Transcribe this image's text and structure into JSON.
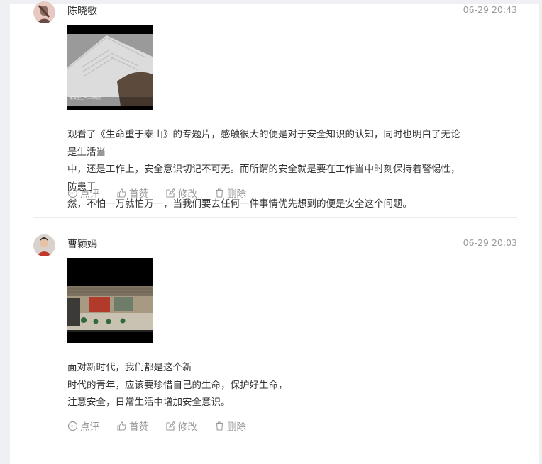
{
  "posts": [
    {
      "username": "陈晓敏",
      "time": "06-29 20:43",
      "thumb_caption": "家安全生产工作规划",
      "content_lines": [
        "观看了《生命重于泰山》的专题片，感触很大的便是对于安全知识的认知，同时也明白了无论是生活当",
        "中，还是工作上，安全意识切记不可无。而所谓的安全就是要在工作当中时刻保持着警惕性，防患于",
        "然，不怕一万就怕万一，当我们要去任何一件事情优先想到的便是安全这个问题。"
      ],
      "actions": {
        "comment": "点评",
        "top": "首赞",
        "edit": "修改",
        "delete": "删除"
      }
    },
    {
      "username": "曹颖嫣",
      "time": "06-29 20:03",
      "content_lines": [
        "面对新时代，我们都是这个新",
        "时代的青年，应该要珍惜自己的生命，保护好生命，",
        "注意安全，日常生活中增加安全意识。"
      ],
      "actions": {
        "comment": "点评",
        "top": "首赞",
        "edit": "修改",
        "delete": "删除"
      }
    }
  ]
}
